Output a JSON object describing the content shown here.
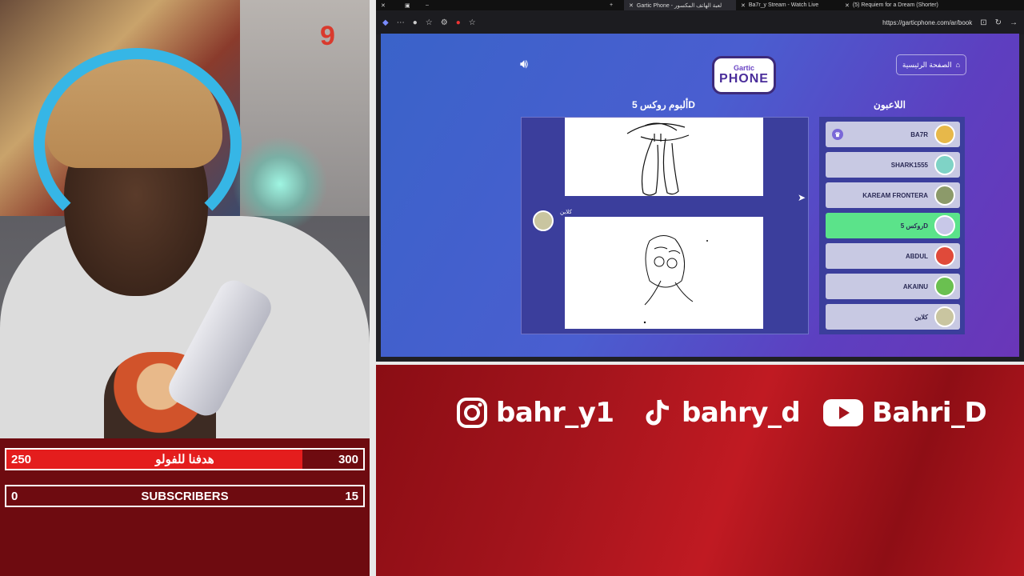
{
  "stream": {
    "counter": "9"
  },
  "goals": {
    "likes": {
      "current": "250",
      "label": "هدفنا للفولو",
      "target": "300",
      "progress": 0.83
    },
    "subs": {
      "current": "0",
      "label": "SUBSCRIBERS",
      "target": "15",
      "progress": 0.0
    }
  },
  "browser": {
    "tabs": [
      {
        "label": "Gartic Phone - لعبة الهاتف المكسور",
        "icon": "gartic-icon"
      },
      {
        "label": "Ba7r_y Stream - Watch Live",
        "icon": "kick-icon"
      },
      {
        "label": "(5) Requiem for a Dream (Shorter)",
        "icon": "youtube-icon"
      }
    ],
    "url": "https://garticphone.com/ar/book"
  },
  "game": {
    "logo_top": "Gartic",
    "logo_main": "PHONE",
    "home_button": "الصفحة الرئيسية",
    "album_title": "ألبوم روكس 5D",
    "players_title": "اللاعبون",
    "author_label": "كلاين",
    "players": [
      {
        "name": "BA7R",
        "color": "#e7b84a",
        "host": true,
        "active": false
      },
      {
        "name": "SHARK1555",
        "color": "#7fd3c6",
        "host": false,
        "active": false
      },
      {
        "name": "KAREAM FRONTERA",
        "color": "#8c9a6a",
        "host": false,
        "active": false
      },
      {
        "name": "روكس 5D",
        "color": "#c8c8e8",
        "host": false,
        "active": true
      },
      {
        "name": "ABDUL",
        "color": "#e04a3a",
        "host": false,
        "active": false
      },
      {
        "name": "AKAINU",
        "color": "#6ac050",
        "host": false,
        "active": false
      },
      {
        "name": "كلاين",
        "color": "#c9c5a0",
        "host": false,
        "active": false
      }
    ]
  },
  "socials": {
    "instagram": "bahr_y1",
    "tiktok": "bahry_d",
    "youtube": "Bahri_D"
  },
  "colors": {
    "accent_red": "#e41d1d",
    "active_player": "#5be38a",
    "panel_blue": "#3b3e9c"
  }
}
